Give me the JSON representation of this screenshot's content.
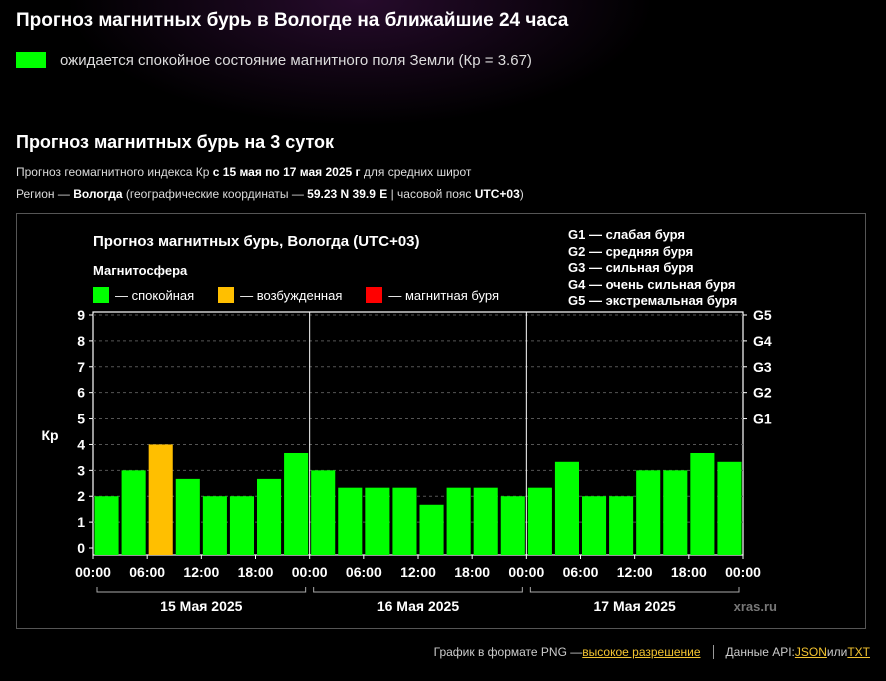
{
  "header": {
    "title": "Прогноз магнитных бурь в Вологде на ближайшие 24 часа",
    "now_status": "ожидается спокойное состояние магнитного поля Земли (Кр = 3.67)",
    "now_color": "#00ff00"
  },
  "forecast": {
    "title": "Прогноз магнитных бурь на 3 суток",
    "line1_pre": "Прогноз геомагнитного индекса Кр ",
    "line1_bold": "с 15 мая по 17 мая 2025 г",
    "line1_post": " для средних широт",
    "line2_pre": "Регион — ",
    "line2_region": "Вологда",
    "line2_mid": " (географические координаты — ",
    "line2_coords": "59.23 N 39.9 E",
    "line2_mid2": " | часовой пояс ",
    "line2_tz": "UTC+03",
    "line2_post": ")"
  },
  "chart_data": {
    "type": "bar",
    "title": "Прогноз магнитных бурь, Вологда (UTC+03)",
    "legend_title": "Магнитосфера",
    "legend": [
      {
        "label": "— спокойная",
        "color": "#00ff00"
      },
      {
        "label": "— возбужденная",
        "color": "#ffbf00"
      },
      {
        "label": "— магнитная буря",
        "color": "#ff0000"
      }
    ],
    "storm_levels": [
      "G1 — слабая буря",
      "G2 — средняя буря",
      "G3 — сильная буря",
      "G4 — очень сильная буря",
      "G5 — экстремальная буря"
    ],
    "ylabel": "Кр",
    "ylim": [
      0,
      9
    ],
    "yticks": [
      "0",
      "1",
      "2",
      "3",
      "4",
      "5",
      "6",
      "7",
      "8",
      "9"
    ],
    "right_ticks": [
      {
        "label": "G1",
        "value": 5
      },
      {
        "label": "G2",
        "value": 6
      },
      {
        "label": "G3",
        "value": 7
      },
      {
        "label": "G4",
        "value": 8
      },
      {
        "label": "G5",
        "value": 9
      }
    ],
    "xtick_labels": [
      "00:00",
      "06:00",
      "12:00",
      "18:00",
      "00:00",
      "06:00",
      "12:00",
      "18:00",
      "00:00",
      "06:00",
      "12:00",
      "18:00",
      "00:00"
    ],
    "days": [
      "15 Мая 2025",
      "16 Мая 2025",
      "17 Мая 2025"
    ],
    "values": [
      2.0,
      3.0,
      4.0,
      2.67,
      2.0,
      2.0,
      2.67,
      3.67,
      3.0,
      2.33,
      2.33,
      2.33,
      1.67,
      2.33,
      2.33,
      2.0,
      2.33,
      3.33,
      2.0,
      2.0,
      3.0,
      3.0,
      3.67,
      3.33
    ],
    "colors": [
      "#00ff00",
      "#00ff00",
      "#ffbf00",
      "#00ff00",
      "#00ff00",
      "#00ff00",
      "#00ff00",
      "#00ff00",
      "#00ff00",
      "#00ff00",
      "#00ff00",
      "#00ff00",
      "#00ff00",
      "#00ff00",
      "#00ff00",
      "#00ff00",
      "#00ff00",
      "#00ff00",
      "#00ff00",
      "#00ff00",
      "#00ff00",
      "#00ff00",
      "#00ff00",
      "#00ff00"
    ],
    "watermark": "xras.ru"
  },
  "footer": {
    "png_text": "График в формате PNG — ",
    "png_link": "высокое разрешение",
    "api_text": "Данные API: ",
    "json_link": "JSON",
    "or_text": " или ",
    "txt_link": "TXT"
  }
}
